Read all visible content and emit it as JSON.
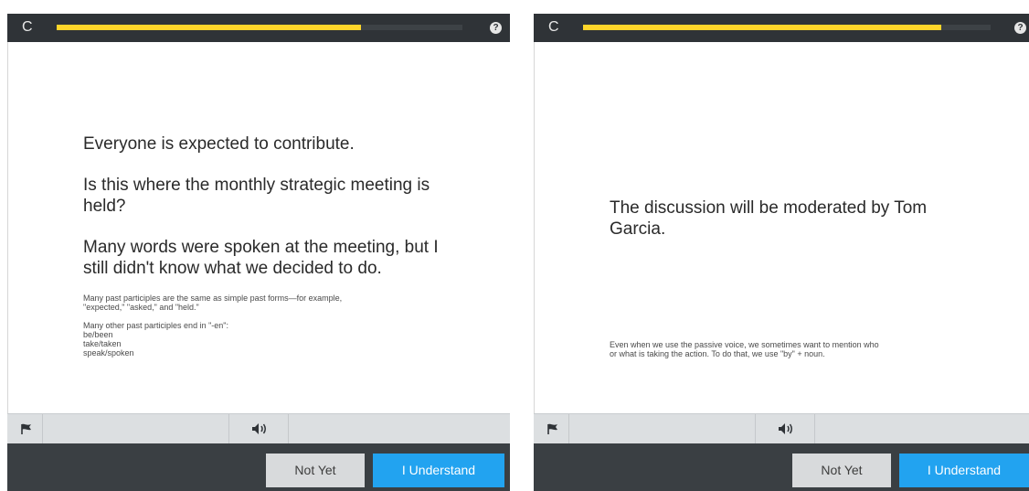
{
  "left_card": {
    "progress_fraction": 0.75,
    "sentences": [
      "Everyone is expected to contribute.",
      "Is this where the monthly strategic meeting is held?",
      "Many words were spoken at the meeting, but I still didn't know what we decided to do."
    ],
    "notes": [
      "Many past participles are the same as simple past forms—for example,",
      "\"expected,\" \"asked,\" and \"held.\"",
      "",
      "Many other past participles end in \"-en\":",
      "be/been",
      "take/taken",
      "speak/spoken"
    ],
    "buttons": {
      "not_yet": "Not Yet",
      "understand": "I Understand"
    }
  },
  "right_card": {
    "progress_fraction": 0.88,
    "sentence": "The discussion will be moderated by Tom Garcia.",
    "notes": [
      "Even when we use the passive voice, we sometimes want to mention who",
      "or what is taking the action. To do that, we use \"by\" + noun."
    ],
    "buttons": {
      "not_yet": "Not Yet",
      "understand": "I Understand"
    }
  },
  "icons": {
    "reload": "reload-icon",
    "help": "help-icon",
    "flag": "flag-icon",
    "audio": "speaker-icon",
    "help_glyph": "?",
    "reload_glyph": "C"
  },
  "colors": {
    "topbar": "#2f3337",
    "progress": "#ffd52a",
    "toolbar": "#dcdfe1",
    "footer": "#3a3f43",
    "primary_button": "#22a3f0",
    "secondary_button": "#d8dadc"
  }
}
